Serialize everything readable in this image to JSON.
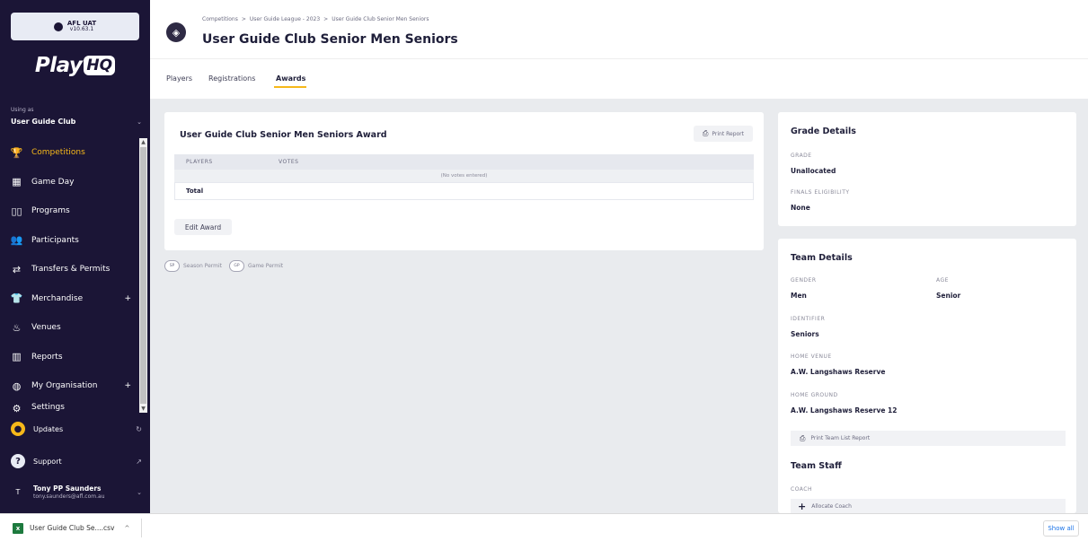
{
  "env": {
    "name": "AFL UAT",
    "version": "v10.63.1"
  },
  "logo": {
    "text": "Play",
    "badge": "HQ"
  },
  "org": {
    "using_as_label": "Using as",
    "name": "User Guide Club"
  },
  "nav": [
    {
      "label": "Competitions",
      "icon": "trophy-icon",
      "glyph": "🏆",
      "active": true
    },
    {
      "label": "Game Day",
      "icon": "scoreboard-icon",
      "glyph": "▦"
    },
    {
      "label": "Programs",
      "icon": "book-icon",
      "glyph": "▯▯"
    },
    {
      "label": "Participants",
      "icon": "people-icon",
      "glyph": "👥"
    },
    {
      "label": "Transfers & Permits",
      "icon": "transfer-icon",
      "glyph": "⇄"
    },
    {
      "label": "Merchandise",
      "icon": "shirt-icon",
      "glyph": "👕",
      "plus": "+"
    },
    {
      "label": "Venues",
      "icon": "stadium-icon",
      "glyph": "♨"
    },
    {
      "label": "Reports",
      "icon": "report-icon",
      "glyph": "▥"
    },
    {
      "label": "My Organisation",
      "icon": "globe-icon",
      "glyph": "◍",
      "plus": "+"
    },
    {
      "label": "Settings",
      "icon": "settings-icon",
      "glyph": "⚙"
    }
  ],
  "bottom": {
    "updates": "Updates",
    "support": "Support",
    "user_initial": "T",
    "user_name": "Tony PP Saunders",
    "user_email": "tony.saunders@afl.com.au"
  },
  "breadcrumb": [
    "Competitions",
    ">",
    "User Guide League - 2023",
    ">",
    "User Guide Club Senior Men Seniors"
  ],
  "page_title": "User Guide Club Senior Men Seniors",
  "tabs": [
    "Players",
    "Registrations",
    "Awards"
  ],
  "active_tab": "Awards",
  "award": {
    "title": "User Guide Club Senior Men Seniors Award",
    "print_label": "Print Report",
    "col_players": "PLAYERS",
    "col_votes": "VOTES",
    "empty_text": "(No votes entered)",
    "total_label": "Total",
    "edit_label": "Edit Award"
  },
  "permits": [
    {
      "badge": "SP",
      "label": "Season Permit"
    },
    {
      "badge": "GP",
      "label": "Game Permit"
    }
  ],
  "grade": {
    "title": "Grade Details",
    "grade_label": "GRADE",
    "grade_value": "Unallocated",
    "finals_label": "FINALS ELIGIBILITY",
    "finals_value": "None"
  },
  "team": {
    "title": "Team Details",
    "gender_label": "GENDER",
    "gender_value": "Men",
    "age_label": "AGE",
    "age_value": "Senior",
    "identifier_label": "IDENTIFIER",
    "identifier_value": "Seniors",
    "venue_label": "HOME VENUE",
    "venue_value": "A.W. Langshaws Reserve",
    "ground_label": "HOME GROUND",
    "ground_value": "A.W. Langshaws Reserve 12",
    "print_label": "Print Team List Report",
    "staff_title": "Team Staff",
    "coach_label": "COACH",
    "allocate_label": "Allocate Coach"
  },
  "downloads": {
    "file": "User Guide Club Se....csv",
    "show_all": "Show all"
  },
  "colors": {
    "sidebar": "#1b1536",
    "accent": "#f6b81a",
    "background": "#e9ebee"
  }
}
